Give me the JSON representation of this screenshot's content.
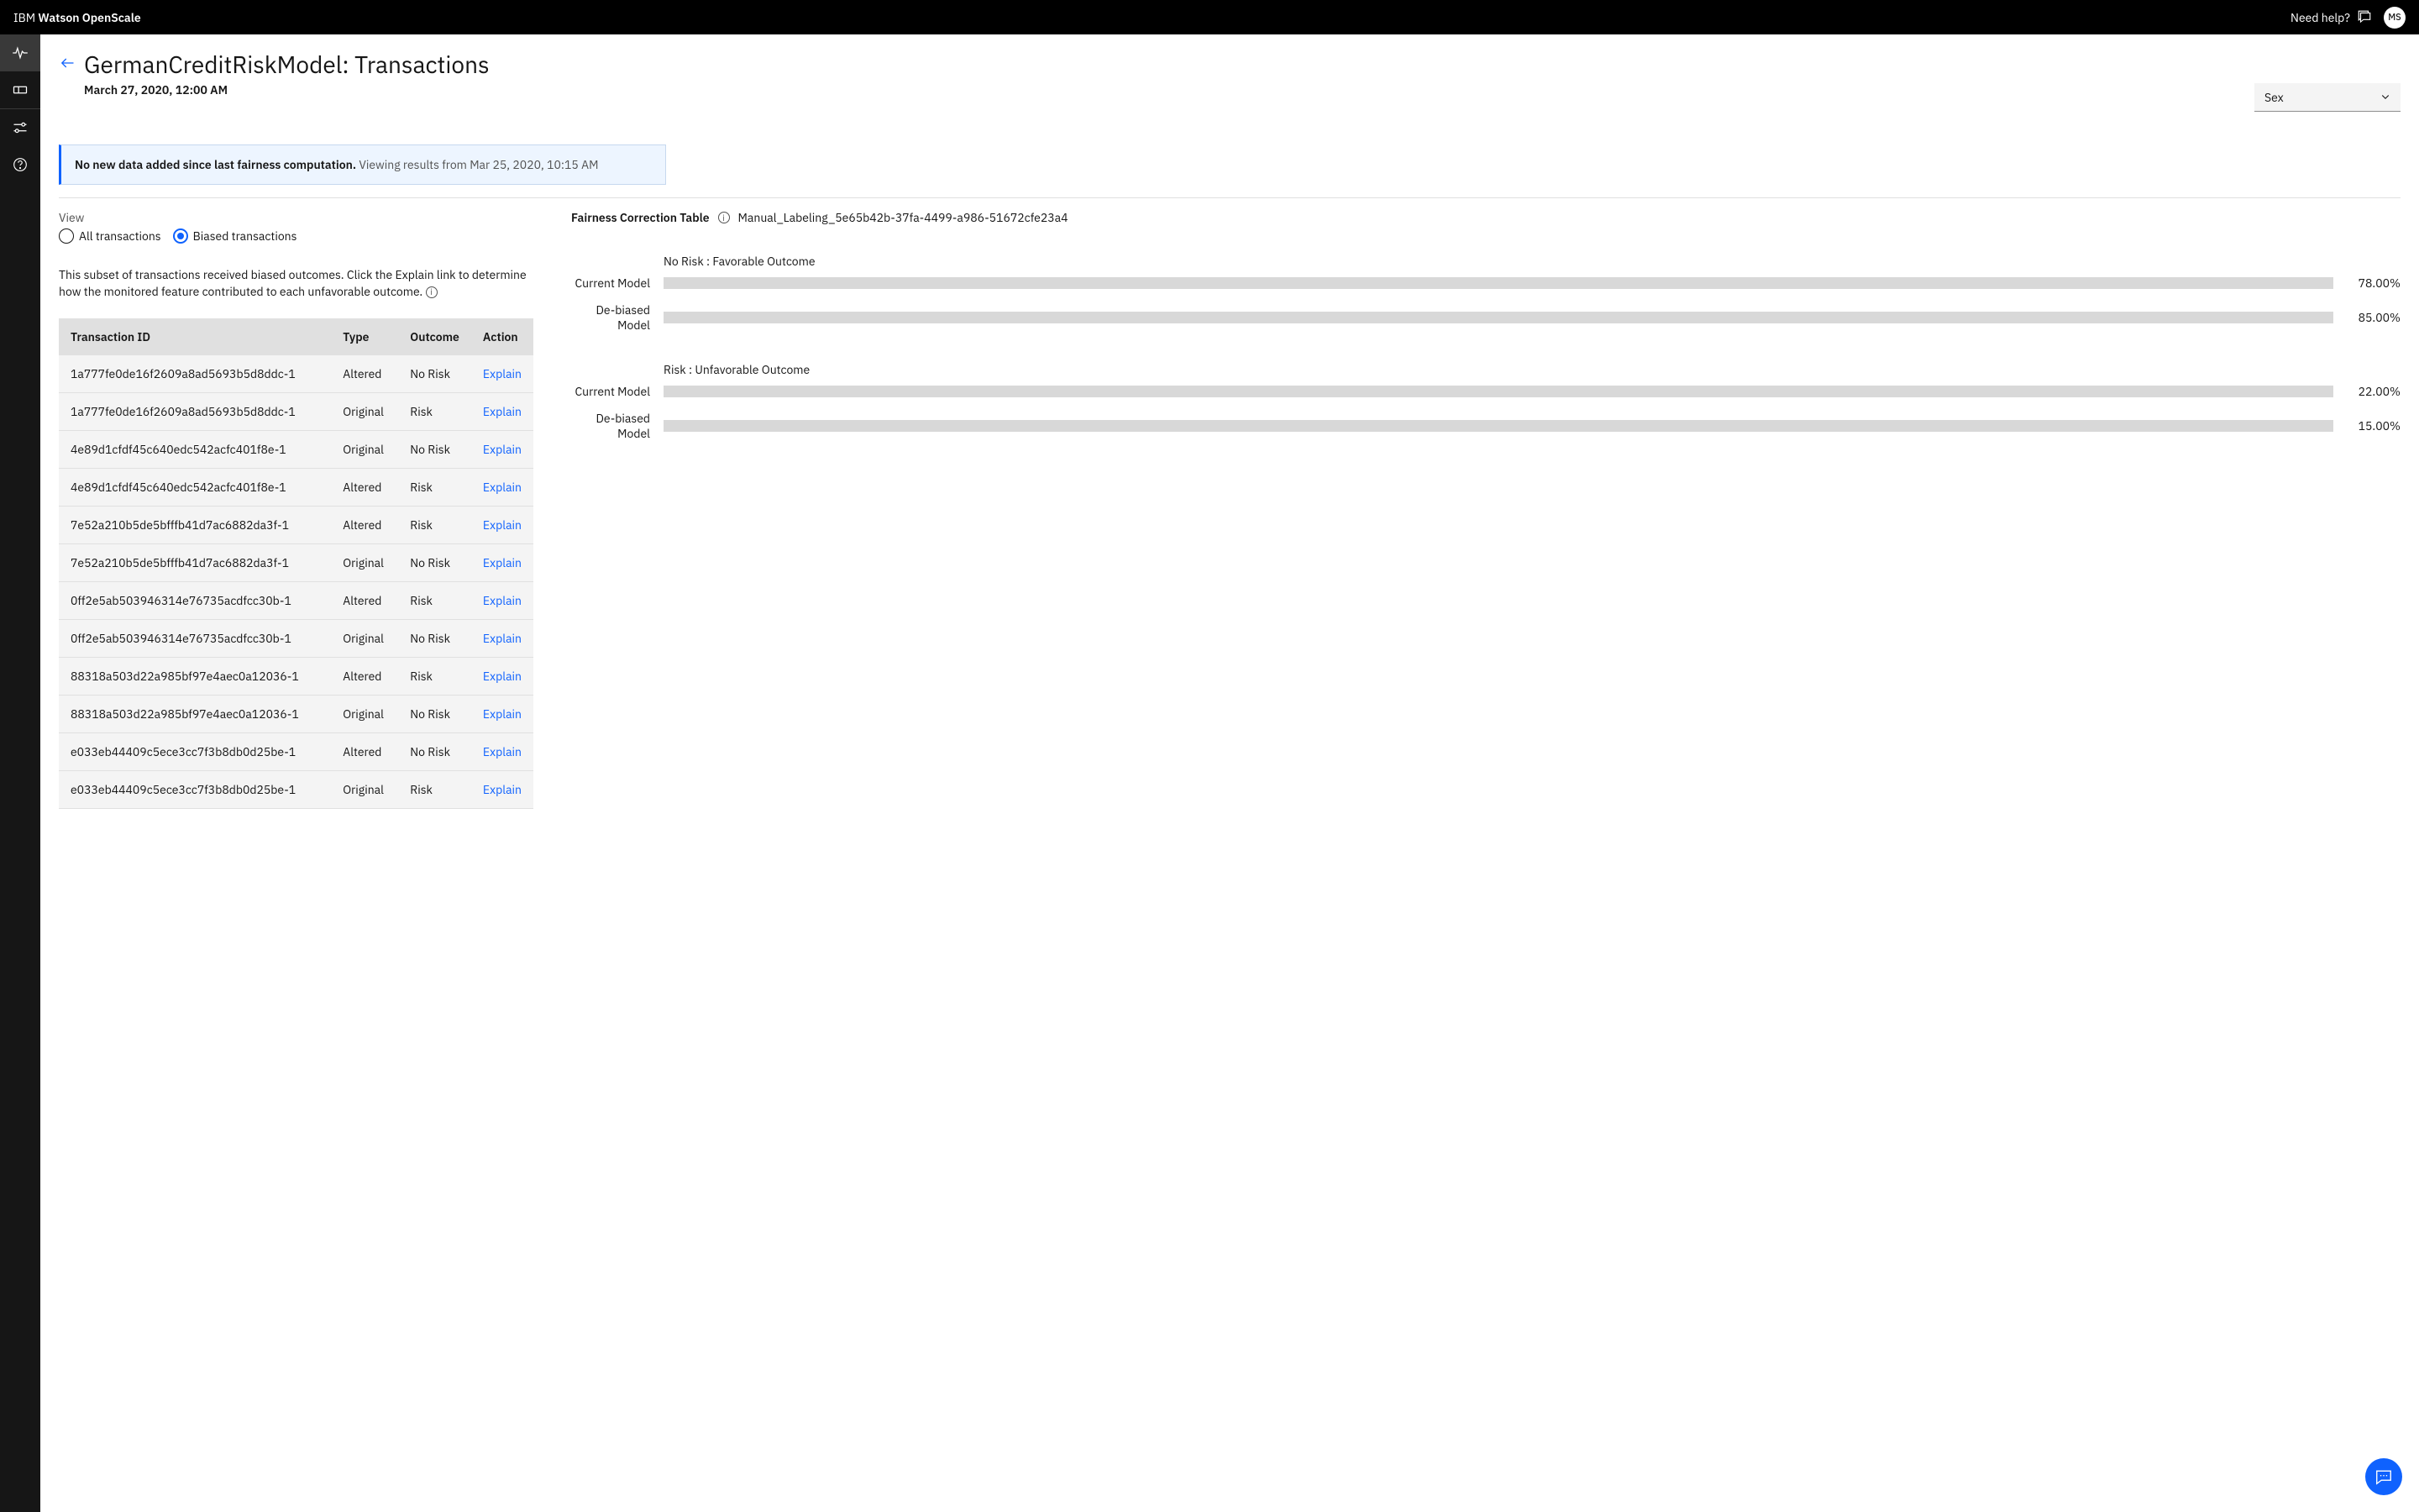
{
  "topbar": {
    "brand_prefix": "IBM ",
    "brand_bold": "Watson OpenScale",
    "help_label": "Need help?",
    "avatar_initials": "MS"
  },
  "page": {
    "title": "GermanCreditRiskModel: Transactions",
    "subtitle": "March 27, 2020, 12:00 AM"
  },
  "dropdown": {
    "selected": "Sex"
  },
  "banner": {
    "bold": "No new data added since last fairness computation.",
    "light": " Viewing results from Mar 25, 2020, 10:15 AM"
  },
  "view": {
    "label": "View",
    "options": [
      "All transactions",
      "Biased transactions"
    ],
    "selected_index": 1
  },
  "description": "This subset of transactions received biased outcomes. Click the Explain link to determine how the monitored feature contributed to each unfavorable outcome.",
  "table": {
    "headers": [
      "Transaction ID",
      "Type",
      "Outcome",
      "Action"
    ],
    "action_label": "Explain",
    "rows": [
      {
        "id": "1a777fe0de16f2609a8ad5693b5d8ddc-1",
        "type": "Altered",
        "outcome": "No Risk"
      },
      {
        "id": "1a777fe0de16f2609a8ad5693b5d8ddc-1",
        "type": "Original",
        "outcome": "Risk"
      },
      {
        "id": "4e89d1cfdf45c640edc542acfc401f8e-1",
        "type": "Original",
        "outcome": "No Risk"
      },
      {
        "id": "4e89d1cfdf45c640edc542acfc401f8e-1",
        "type": "Altered",
        "outcome": "Risk"
      },
      {
        "id": "7e52a210b5de5bfffb41d7ac6882da3f-1",
        "type": "Altered",
        "outcome": "Risk"
      },
      {
        "id": "7e52a210b5de5bfffb41d7ac6882da3f-1",
        "type": "Original",
        "outcome": "No Risk"
      },
      {
        "id": "0ff2e5ab503946314e76735acdfcc30b-1",
        "type": "Altered",
        "outcome": "Risk"
      },
      {
        "id": "0ff2e5ab503946314e76735acdfcc30b-1",
        "type": "Original",
        "outcome": "No Risk"
      },
      {
        "id": "88318a503d22a985bf97e4aec0a12036-1",
        "type": "Altered",
        "outcome": "Risk"
      },
      {
        "id": "88318a503d22a985bf97e4aec0a12036-1",
        "type": "Original",
        "outcome": "No Risk"
      },
      {
        "id": "e033eb44409c5ece3cc7f3b8db0d25be-1",
        "type": "Altered",
        "outcome": "No Risk"
      },
      {
        "id": "e033eb44409c5ece3cc7f3b8db0d25be-1",
        "type": "Original",
        "outcome": "Risk"
      }
    ]
  },
  "fairness": {
    "title": "Fairness Correction Table",
    "id": "Manual_Labeling_5e65b42b-37fa-4499-a986-51672cfe23a4",
    "groups": [
      {
        "label": "No Risk : Favorable Outcome",
        "color": "blue",
        "bars": [
          {
            "label": "Current Model",
            "pct": 78.0,
            "pct_display": "78.00%"
          },
          {
            "label": "De-biased Model",
            "pct": 85.0,
            "pct_display": "85.00%"
          }
        ]
      },
      {
        "label": "Risk : Unfavorable Outcome",
        "color": "dark",
        "bars": [
          {
            "label": "Current Model",
            "pct": 22.0,
            "pct_display": "22.00%"
          },
          {
            "label": "De-biased Model",
            "pct": 15.0,
            "pct_display": "15.00%"
          }
        ]
      }
    ]
  },
  "chart_data": {
    "type": "bar",
    "orientation": "horizontal",
    "series": [
      {
        "name": "No Risk : Favorable Outcome",
        "categories": [
          "Current Model",
          "De-biased Model"
        ],
        "values": [
          78.0,
          85.0
        ],
        "color": "#1f5ef8"
      },
      {
        "name": "Risk : Unfavorable Outcome",
        "categories": [
          "Current Model",
          "De-biased Model"
        ],
        "values": [
          22.0,
          15.0
        ],
        "color": "#3d3d3d"
      }
    ],
    "xlim": [
      0,
      100
    ],
    "unit": "%"
  }
}
